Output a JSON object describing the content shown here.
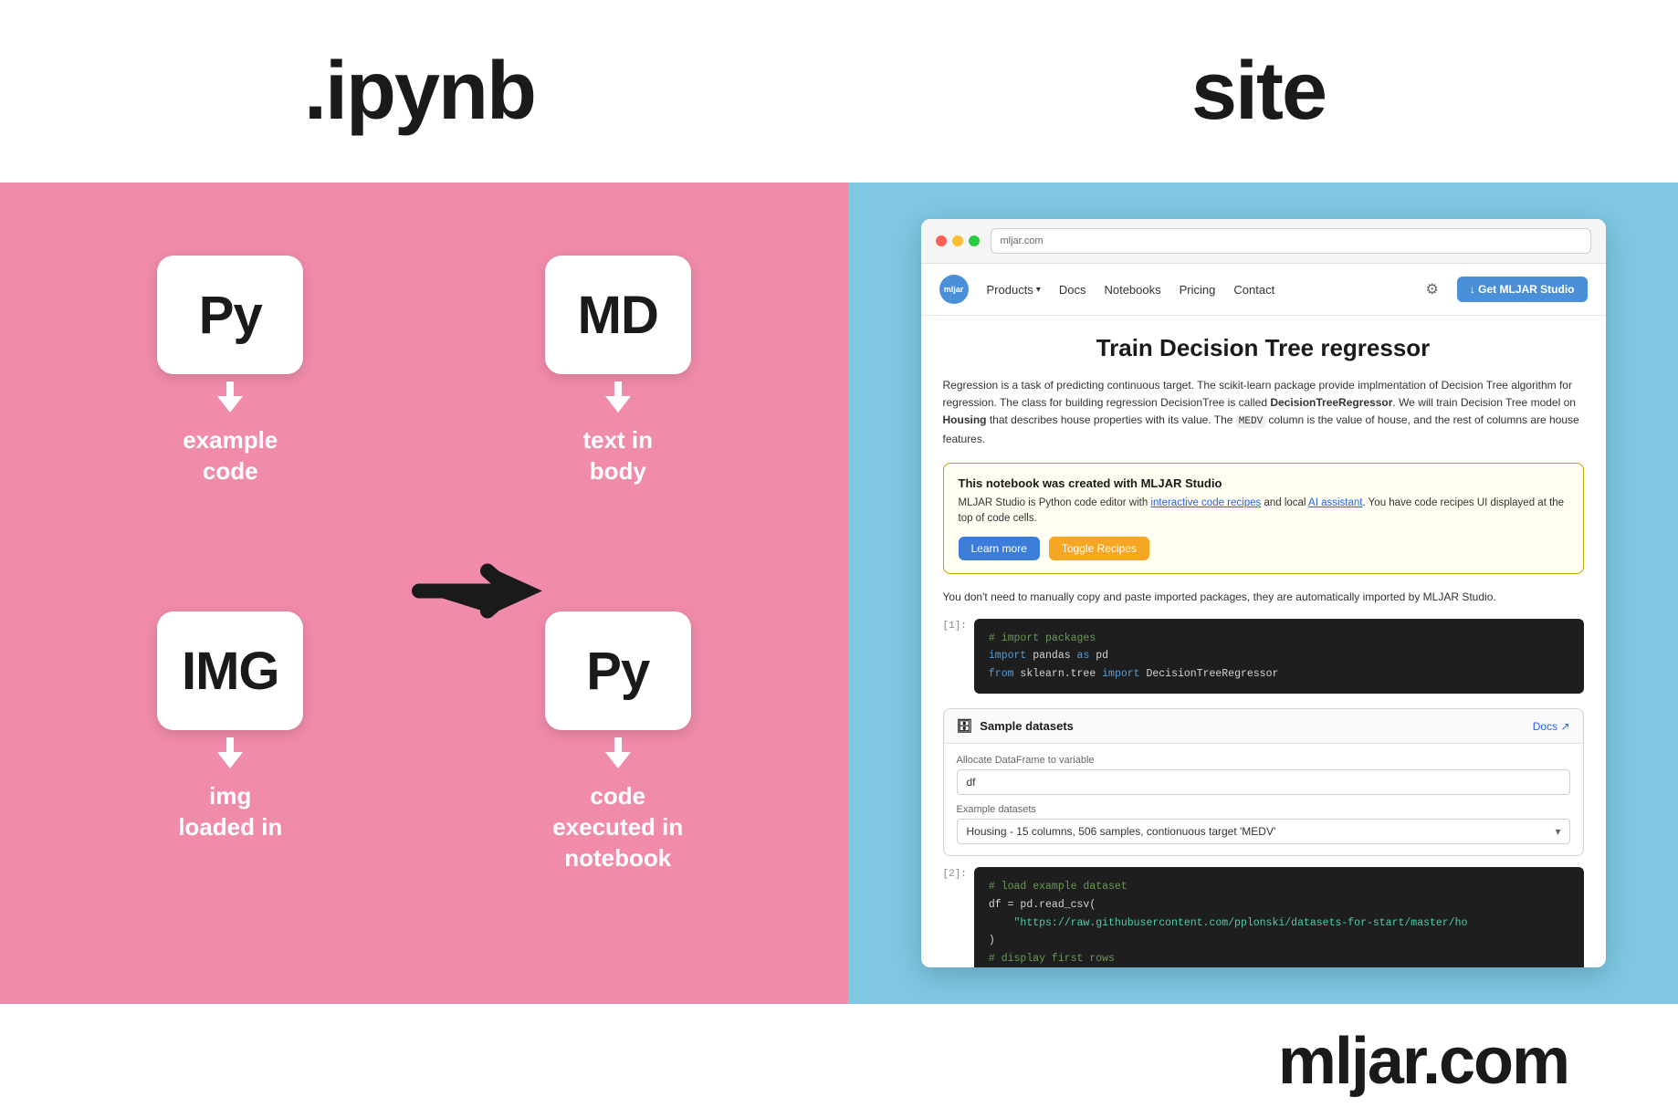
{
  "top": {
    "left_label": ".ipynb",
    "right_label": "site"
  },
  "left_panel": {
    "items": [
      {
        "id": "py-code",
        "card_text": "Py",
        "label": "example\ncode"
      },
      {
        "id": "md-body",
        "card_text": "MD",
        "label": "text in\nbody"
      },
      {
        "id": "img-load",
        "card_text": "IMG",
        "label": "img\nloaded in"
      },
      {
        "id": "py-exec",
        "card_text": "Py",
        "label": "code\nexecuted in\nnotebook"
      }
    ]
  },
  "right_panel": {
    "browser": {
      "url": "mljar.com",
      "nav": {
        "logo": "mljar",
        "items": [
          "Products",
          "Docs",
          "Notebooks",
          "Pricing",
          "Contact"
        ],
        "cta_button": "↓ Get MLJAR Studio"
      },
      "page": {
        "title": "Train Decision Tree regressor",
        "description": "Regression is a task of predicting continuous target. The scikit-learn package provide implmentation of Decision Tree algorithm for regression. The class for building regression DecisionTree is called DecisionTreeRegressor. We will train Decision Tree model on Housing that describes house properties with its value. The MEDV column is the value of house, and the rest of columns are house features.",
        "promo_box": {
          "title": "This notebook was created with MLJAR Studio",
          "text_1": "MLJAR Studio is Python code editor with",
          "link_text": "interactive code recipes",
          "text_2": "and local",
          "link_text_2": "AI assistant",
          "text_3": ". You have code recipes UI displayed at the top of code cells.",
          "btn_learn": "Learn more",
          "btn_toggle": "Toggle Recipes"
        },
        "auto_import": "You don't need to manually copy and paste imported packages, they are automatically imported by MLJAR Studio.",
        "code_block_1": {
          "line_num": "[1]:",
          "lines": [
            {
              "type": "comment",
              "text": "# import packages"
            },
            {
              "type": "mixed",
              "parts": [
                {
                  "t": "keyword",
                  "v": "import"
                },
                {
                  "t": "text",
                  "v": " pandas "
                },
                {
                  "t": "keyword",
                  "v": "as"
                },
                {
                  "t": "text",
                  "v": " pd"
                }
              ]
            },
            {
              "type": "mixed",
              "parts": [
                {
                  "t": "keyword",
                  "v": "from"
                },
                {
                  "t": "text",
                  "v": " sklearn.tree "
                },
                {
                  "t": "keyword",
                  "v": "import"
                },
                {
                  "t": "text",
                  "v": " DecisionTreeRegressor"
                }
              ]
            }
          ]
        },
        "dataset_panel": {
          "title": "Sample datasets",
          "docs_link": "Docs ↗",
          "variable_label": "Allocate DataFrame to variable",
          "variable_value": "df",
          "datasets_label": "Example datasets",
          "datasets_value": "Housing - 15 columns, 506 samples, contionuous target 'MEDV'"
        },
        "code_block_2": {
          "line_num": "[2]:",
          "lines": [
            {
              "type": "comment",
              "text": "# load example dataset"
            },
            {
              "type": "mixed",
              "parts": [
                {
                  "t": "text",
                  "v": "df = pd.read_csv("
                }
              ]
            },
            {
              "type": "mixed",
              "parts": [
                {
                  "t": "text",
                  "v": "    "
                },
                {
                  "t": "module",
                  "v": "\"https://raw.githubusercontent.com/pplonski/datasets-for-start/master/ho"
                }
              ]
            },
            {
              "type": "text",
              "text": ")"
            },
            {
              "type": "comment",
              "text": "# display first rows"
            }
          ]
        }
      }
    }
  },
  "footer": {
    "brand": "mljar.com"
  }
}
